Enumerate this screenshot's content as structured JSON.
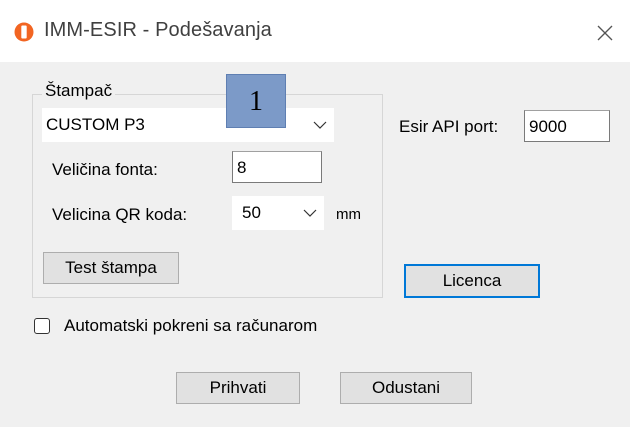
{
  "window": {
    "title": "IMM-ESIR - Podešavanja",
    "accent_color": "#f26522"
  },
  "printer_group": {
    "legend": "Štampač",
    "printer_value": "CUSTOM P3",
    "font_size_label": "Veličina fonta:",
    "font_size_value": "8",
    "qr_size_label": "Velicina QR koda:",
    "qr_size_value": "50",
    "qr_unit": "mm",
    "test_button_label": "Test štampa"
  },
  "api": {
    "port_label": "Esir API port:",
    "port_value": "9000"
  },
  "license_button_label": "Licenca",
  "autostart": {
    "label": "Automatski pokreni sa računarom",
    "checked": false
  },
  "footer": {
    "accept_label": "Prihvati",
    "cancel_label": "Odustani"
  },
  "annotation": {
    "badge_text": "1",
    "badge_color": "#7c9ac8"
  }
}
